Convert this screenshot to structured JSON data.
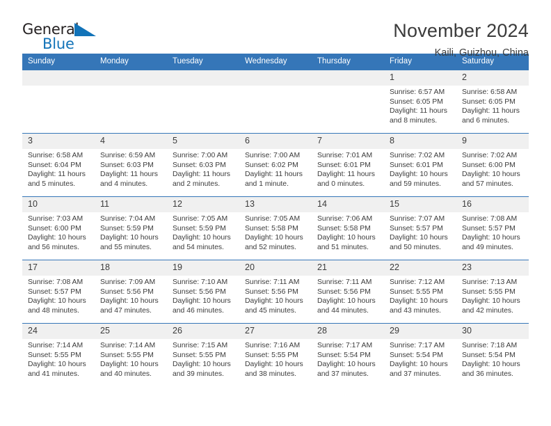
{
  "brand": {
    "word_one": "General",
    "word_two": "Blue",
    "accent_color": "#1273b8"
  },
  "header": {
    "title": "November 2024",
    "location": "Kaili, Guizhou, China"
  },
  "calendar": {
    "header_color": "#3576b8",
    "daynum_band_color": "#f0f0f0",
    "weekday_headers": [
      "Sunday",
      "Monday",
      "Tuesday",
      "Wednesday",
      "Thursday",
      "Friday",
      "Saturday"
    ],
    "weeks": [
      [
        {
          "day": "",
          "sunrise": "",
          "sunset": "",
          "daylight_line1": "",
          "daylight_line2": ""
        },
        {
          "day": "",
          "sunrise": "",
          "sunset": "",
          "daylight_line1": "",
          "daylight_line2": ""
        },
        {
          "day": "",
          "sunrise": "",
          "sunset": "",
          "daylight_line1": "",
          "daylight_line2": ""
        },
        {
          "day": "",
          "sunrise": "",
          "sunset": "",
          "daylight_line1": "",
          "daylight_line2": ""
        },
        {
          "day": "",
          "sunrise": "",
          "sunset": "",
          "daylight_line1": "",
          "daylight_line2": ""
        },
        {
          "day": "1",
          "sunrise": "Sunrise: 6:57 AM",
          "sunset": "Sunset: 6:05 PM",
          "daylight_line1": "Daylight: 11 hours",
          "daylight_line2": "and 8 minutes."
        },
        {
          "day": "2",
          "sunrise": "Sunrise: 6:58 AM",
          "sunset": "Sunset: 6:05 PM",
          "daylight_line1": "Daylight: 11 hours",
          "daylight_line2": "and 6 minutes."
        }
      ],
      [
        {
          "day": "3",
          "sunrise": "Sunrise: 6:58 AM",
          "sunset": "Sunset: 6:04 PM",
          "daylight_line1": "Daylight: 11 hours",
          "daylight_line2": "and 5 minutes."
        },
        {
          "day": "4",
          "sunrise": "Sunrise: 6:59 AM",
          "sunset": "Sunset: 6:03 PM",
          "daylight_line1": "Daylight: 11 hours",
          "daylight_line2": "and 4 minutes."
        },
        {
          "day": "5",
          "sunrise": "Sunrise: 7:00 AM",
          "sunset": "Sunset: 6:03 PM",
          "daylight_line1": "Daylight: 11 hours",
          "daylight_line2": "and 2 minutes."
        },
        {
          "day": "6",
          "sunrise": "Sunrise: 7:00 AM",
          "sunset": "Sunset: 6:02 PM",
          "daylight_line1": "Daylight: 11 hours",
          "daylight_line2": "and 1 minute."
        },
        {
          "day": "7",
          "sunrise": "Sunrise: 7:01 AM",
          "sunset": "Sunset: 6:01 PM",
          "daylight_line1": "Daylight: 11 hours",
          "daylight_line2": "and 0 minutes."
        },
        {
          "day": "8",
          "sunrise": "Sunrise: 7:02 AM",
          "sunset": "Sunset: 6:01 PM",
          "daylight_line1": "Daylight: 10 hours",
          "daylight_line2": "and 59 minutes."
        },
        {
          "day": "9",
          "sunrise": "Sunrise: 7:02 AM",
          "sunset": "Sunset: 6:00 PM",
          "daylight_line1": "Daylight: 10 hours",
          "daylight_line2": "and 57 minutes."
        }
      ],
      [
        {
          "day": "10",
          "sunrise": "Sunrise: 7:03 AM",
          "sunset": "Sunset: 6:00 PM",
          "daylight_line1": "Daylight: 10 hours",
          "daylight_line2": "and 56 minutes."
        },
        {
          "day": "11",
          "sunrise": "Sunrise: 7:04 AM",
          "sunset": "Sunset: 5:59 PM",
          "daylight_line1": "Daylight: 10 hours",
          "daylight_line2": "and 55 minutes."
        },
        {
          "day": "12",
          "sunrise": "Sunrise: 7:05 AM",
          "sunset": "Sunset: 5:59 PM",
          "daylight_line1": "Daylight: 10 hours",
          "daylight_line2": "and 54 minutes."
        },
        {
          "day": "13",
          "sunrise": "Sunrise: 7:05 AM",
          "sunset": "Sunset: 5:58 PM",
          "daylight_line1": "Daylight: 10 hours",
          "daylight_line2": "and 52 minutes."
        },
        {
          "day": "14",
          "sunrise": "Sunrise: 7:06 AM",
          "sunset": "Sunset: 5:58 PM",
          "daylight_line1": "Daylight: 10 hours",
          "daylight_line2": "and 51 minutes."
        },
        {
          "day": "15",
          "sunrise": "Sunrise: 7:07 AM",
          "sunset": "Sunset: 5:57 PM",
          "daylight_line1": "Daylight: 10 hours",
          "daylight_line2": "and 50 minutes."
        },
        {
          "day": "16",
          "sunrise": "Sunrise: 7:08 AM",
          "sunset": "Sunset: 5:57 PM",
          "daylight_line1": "Daylight: 10 hours",
          "daylight_line2": "and 49 minutes."
        }
      ],
      [
        {
          "day": "17",
          "sunrise": "Sunrise: 7:08 AM",
          "sunset": "Sunset: 5:57 PM",
          "daylight_line1": "Daylight: 10 hours",
          "daylight_line2": "and 48 minutes."
        },
        {
          "day": "18",
          "sunrise": "Sunrise: 7:09 AM",
          "sunset": "Sunset: 5:56 PM",
          "daylight_line1": "Daylight: 10 hours",
          "daylight_line2": "and 47 minutes."
        },
        {
          "day": "19",
          "sunrise": "Sunrise: 7:10 AM",
          "sunset": "Sunset: 5:56 PM",
          "daylight_line1": "Daylight: 10 hours",
          "daylight_line2": "and 46 minutes."
        },
        {
          "day": "20",
          "sunrise": "Sunrise: 7:11 AM",
          "sunset": "Sunset: 5:56 PM",
          "daylight_line1": "Daylight: 10 hours",
          "daylight_line2": "and 45 minutes."
        },
        {
          "day": "21",
          "sunrise": "Sunrise: 7:11 AM",
          "sunset": "Sunset: 5:56 PM",
          "daylight_line1": "Daylight: 10 hours",
          "daylight_line2": "and 44 minutes."
        },
        {
          "day": "22",
          "sunrise": "Sunrise: 7:12 AM",
          "sunset": "Sunset: 5:55 PM",
          "daylight_line1": "Daylight: 10 hours",
          "daylight_line2": "and 43 minutes."
        },
        {
          "day": "23",
          "sunrise": "Sunrise: 7:13 AM",
          "sunset": "Sunset: 5:55 PM",
          "daylight_line1": "Daylight: 10 hours",
          "daylight_line2": "and 42 minutes."
        }
      ],
      [
        {
          "day": "24",
          "sunrise": "Sunrise: 7:14 AM",
          "sunset": "Sunset: 5:55 PM",
          "daylight_line1": "Daylight: 10 hours",
          "daylight_line2": "and 41 minutes."
        },
        {
          "day": "25",
          "sunrise": "Sunrise: 7:14 AM",
          "sunset": "Sunset: 5:55 PM",
          "daylight_line1": "Daylight: 10 hours",
          "daylight_line2": "and 40 minutes."
        },
        {
          "day": "26",
          "sunrise": "Sunrise: 7:15 AM",
          "sunset": "Sunset: 5:55 PM",
          "daylight_line1": "Daylight: 10 hours",
          "daylight_line2": "and 39 minutes."
        },
        {
          "day": "27",
          "sunrise": "Sunrise: 7:16 AM",
          "sunset": "Sunset: 5:55 PM",
          "daylight_line1": "Daylight: 10 hours",
          "daylight_line2": "and 38 minutes."
        },
        {
          "day": "28",
          "sunrise": "Sunrise: 7:17 AM",
          "sunset": "Sunset: 5:54 PM",
          "daylight_line1": "Daylight: 10 hours",
          "daylight_line2": "and 37 minutes."
        },
        {
          "day": "29",
          "sunrise": "Sunrise: 7:17 AM",
          "sunset": "Sunset: 5:54 PM",
          "daylight_line1": "Daylight: 10 hours",
          "daylight_line2": "and 37 minutes."
        },
        {
          "day": "30",
          "sunrise": "Sunrise: 7:18 AM",
          "sunset": "Sunset: 5:54 PM",
          "daylight_line1": "Daylight: 10 hours",
          "daylight_line2": "and 36 minutes."
        }
      ]
    ]
  }
}
